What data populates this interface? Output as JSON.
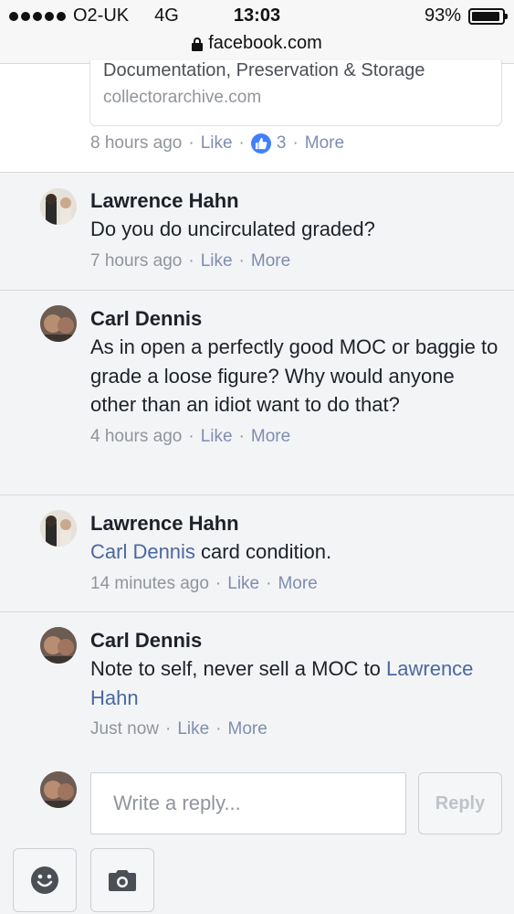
{
  "status_bar": {
    "carrier": "O2-UK",
    "network": "4G",
    "time": "13:03",
    "battery": "93%",
    "battery_level": 0.93,
    "url": "facebook.com"
  },
  "top_comment": {
    "link_title": "Documentation, Preservation & Storage",
    "link_domain": "collectorarchive.com",
    "time": "8 hours ago",
    "like_label": "Like",
    "like_count": "3",
    "more_label": "More"
  },
  "comments": [
    {
      "author": "Lawrence Hahn",
      "text": "Do you do uncirculated graded?",
      "time": "7 hours ago",
      "like_label": "Like",
      "more_label": "More"
    },
    {
      "author": "Carl Dennis",
      "text": "As in open a perfectly good MOC or baggie to grade a loose figure? Why would anyone other than an idiot want to do that?",
      "time": "4 hours ago",
      "like_label": "Like",
      "more_label": "More"
    },
    {
      "author": "Lawrence Hahn",
      "mention": "Carl Dennis",
      "text": " card condition.",
      "time": "14 minutes ago",
      "like_label": "Like",
      "more_label": "More"
    },
    {
      "author": "Carl Dennis",
      "text": "Note to self, never sell a MOC to ",
      "mention": "Lawrence Hahn",
      "time": "Just now",
      "like_label": "Like",
      "more_label": "More"
    }
  ],
  "reply": {
    "placeholder": "Write a reply...",
    "button_label": "Reply"
  },
  "icons": {
    "emoji": "smiley-icon",
    "camera": "camera-icon",
    "like_badge": "thumbs-up-icon"
  },
  "colors": {
    "like_blue": "#4080ff",
    "link_gray_blue": "#7f8db0",
    "mention_blue": "#4b67a1"
  }
}
